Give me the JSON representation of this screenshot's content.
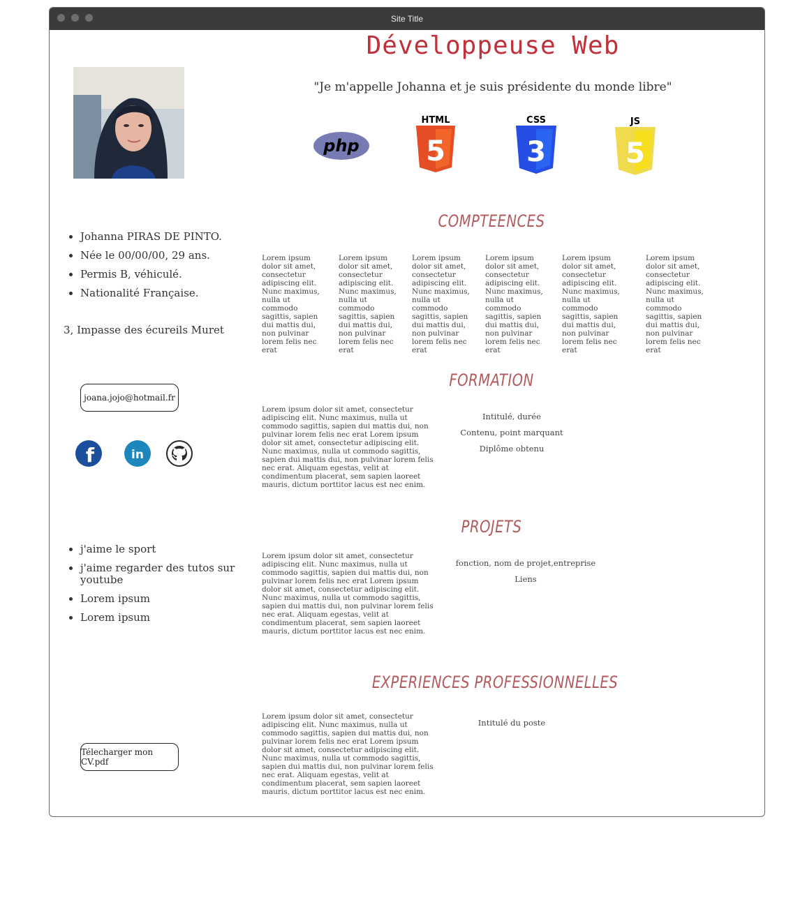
{
  "window": {
    "title": "Site Title"
  },
  "header": {
    "headline": "Développeuse Web",
    "quote": "\"Je m'appelle Johanna et je suis présidente du monde libre\""
  },
  "logos": {
    "php": "php",
    "html": "HTML",
    "html_digit": "5",
    "css": "CSS",
    "css_digit": "3",
    "js": "JS",
    "js_digit": "5"
  },
  "profile": {
    "info": [
      "Johanna PIRAS DE PINTO.",
      "Née le 00/00/00, 29 ans.",
      "Permis B, véhiculé.",
      "Nationalité Française."
    ],
    "address": "3, Impasse des écureils Muret",
    "email_button": "joana.jojo@hotmail.fr",
    "hobbies": [
      "j'aime le sport",
      "j'aime regarder des tutos sur youtube",
      "Lorem ipsum",
      "Lorem ipsum"
    ],
    "download_button": "Télecharger mon CV.pdf"
  },
  "social": {
    "facebook": "f",
    "linkedin": "in"
  },
  "sections": {
    "competences": {
      "title": "COMPTEENCES",
      "columns": [
        "Lorem ipsum dolor sit amet, consectetur adipiscing elit. Nunc maximus, nulla ut commodo sagittis, sapien dui mattis dui, non pulvinar lorem felis nec erat",
        "Lorem ipsum dolor sit amet, consectetur adipiscing elit. Nunc maximus, nulla ut commodo sagittis, sapien dui mattis dui, non pulvinar lorem felis nec erat",
        "Lorem ipsum dolor sit amet, consectetur adipiscing elit. Nunc maximus, nulla ut commodo sagittis, sapien dui mattis dui, non pulvinar lorem felis nec erat",
        "Lorem ipsum dolor sit amet, consectetur adipiscing elit. Nunc maximus, nulla ut commodo sagittis, sapien dui mattis dui, non pulvinar lorem felis nec erat",
        "Lorem ipsum dolor sit amet, consectetur adipiscing elit. Nunc maximus, nulla ut commodo sagittis, sapien dui mattis dui, non pulvinar lorem felis nec erat",
        "Lorem ipsum dolor sit amet, consectetur adipiscing elit. Nunc maximus, nulla ut commodo sagittis, sapien dui mattis dui, non pulvinar lorem felis nec erat"
      ]
    },
    "formation": {
      "title": "FORMATION",
      "text": "Lorem ipsum dolor sit amet, consectetur adipiscing elit. Nunc maximus, nulla ut commodo sagittis, sapien dui mattis dui, non pulvinar lorem felis nec erat Lorem ipsum dolor sit amet, consectetur adipiscing elit. Nunc maximus, nulla ut commodo sagittis, sapien dui mattis dui, non pulvinar lorem felis nec erat. Aliquam egestas, velit at condimentum placerat, sem sapien laoreet mauris, dictum porttitor lacus est nec enim. Vivamus feugiat elit lorem, eu porttitor ante ultrices id. Phasellus suscipit tellus",
      "details": [
        "Intitulé, durée",
        "Contenu, point marquant",
        "Diplôme obtenu"
      ]
    },
    "projets": {
      "title": "PROJETS",
      "text": "Lorem ipsum dolor sit amet, consectetur adipiscing elit. Nunc maximus, nulla ut commodo sagittis, sapien dui mattis dui, non pulvinar lorem felis nec erat Lorem ipsum dolor sit amet, consectetur adipiscing elit. Nunc maximus, nulla ut commodo sagittis, sapien dui mattis dui, non pulvinar lorem felis nec erat. Aliquam egestas, velit at condimentum placerat, sem sapien laoreet mauris, dictum porttitor lacus est nec enim. Vivamus feugiat elit lorem, eu porttitor ante ultrices id. Phasellus suscipit tellus",
      "details": [
        "fonction, nom de projet,entreprise",
        "Liens"
      ]
    },
    "experiences": {
      "title": "EXPERIENCES PROFESSIONNELLES",
      "text": "Lorem ipsum dolor sit amet, consectetur adipiscing elit. Nunc maximus, nulla ut commodo sagittis, sapien dui mattis dui, non pulvinar lorem felis nec erat Lorem ipsum dolor sit amet, consectetur adipiscing elit. Nunc maximus, nulla ut commodo sagittis, sapien dui mattis dui, non pulvinar lorem felis nec erat. Aliquam egestas, velit at condimentum placerat, sem sapien laoreet mauris, dictum porttitor lacus est nec enim. Vivamus feugiat elit lorem, eu porttitor ante ultrices id. Phasellus suscipit tellus",
      "details": [
        "Intitulé du poste"
      ]
    }
  },
  "colors": {
    "headline": "#c0313b",
    "section_title": "#b35a5e",
    "titlebar": "#3b3b3b",
    "php": "#777bb3",
    "html": "#e44d26",
    "css": "#264de4",
    "js": "#f0db4f",
    "facebook": "#1b4f9c",
    "linkedin": "#1d87bd"
  }
}
